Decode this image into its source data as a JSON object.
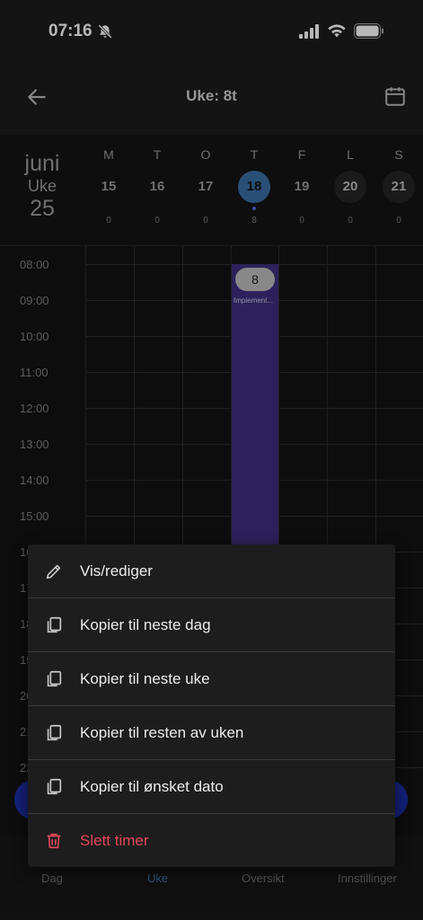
{
  "status_bar": {
    "time": "07:16"
  },
  "header": {
    "title": "Uke: 8t"
  },
  "week": {
    "month": "juni",
    "week_label": "Uke",
    "week_number": "25",
    "days": [
      {
        "letter": "M",
        "date": "15",
        "hours": "0"
      },
      {
        "letter": "T",
        "date": "16",
        "hours": "0"
      },
      {
        "letter": "O",
        "date": "17",
        "hours": "0"
      },
      {
        "letter": "T",
        "date": "18",
        "hours": "8"
      },
      {
        "letter": "F",
        "date": "19",
        "hours": "0"
      },
      {
        "letter": "L",
        "date": "20",
        "hours": "0"
      },
      {
        "letter": "S",
        "date": "21",
        "hours": "0"
      }
    ]
  },
  "grid": {
    "times": [
      "08:00",
      "09:00",
      "10:00",
      "11:00",
      "12:00",
      "13:00",
      "14:00",
      "15:00",
      "16",
      "17",
      "18",
      "19",
      "20",
      "21",
      "22"
    ]
  },
  "event": {
    "hours": "8",
    "label": "Implement..."
  },
  "context_menu": {
    "items": [
      {
        "label": "Vis/rediger",
        "icon": "pencil-icon"
      },
      {
        "label": "Kopier til neste dag",
        "icon": "copy-icon"
      },
      {
        "label": "Kopier til neste uke",
        "icon": "copy-icon"
      },
      {
        "label": "Kopier til resten av uken",
        "icon": "copy-icon"
      },
      {
        "label": "Kopier til ønsket dato",
        "icon": "copy-icon"
      },
      {
        "label": "Slett timer",
        "icon": "trash-icon"
      }
    ]
  },
  "bottom_nav": {
    "items": [
      {
        "label": "Dag"
      },
      {
        "label": "Uke"
      },
      {
        "label": "Oversikt"
      },
      {
        "label": "Innstillinger"
      }
    ]
  },
  "colors": {
    "accent": "#3b6ea5",
    "event": "#3d2f7d",
    "danger": "#e0475a",
    "fab": "#1c2ea8"
  }
}
